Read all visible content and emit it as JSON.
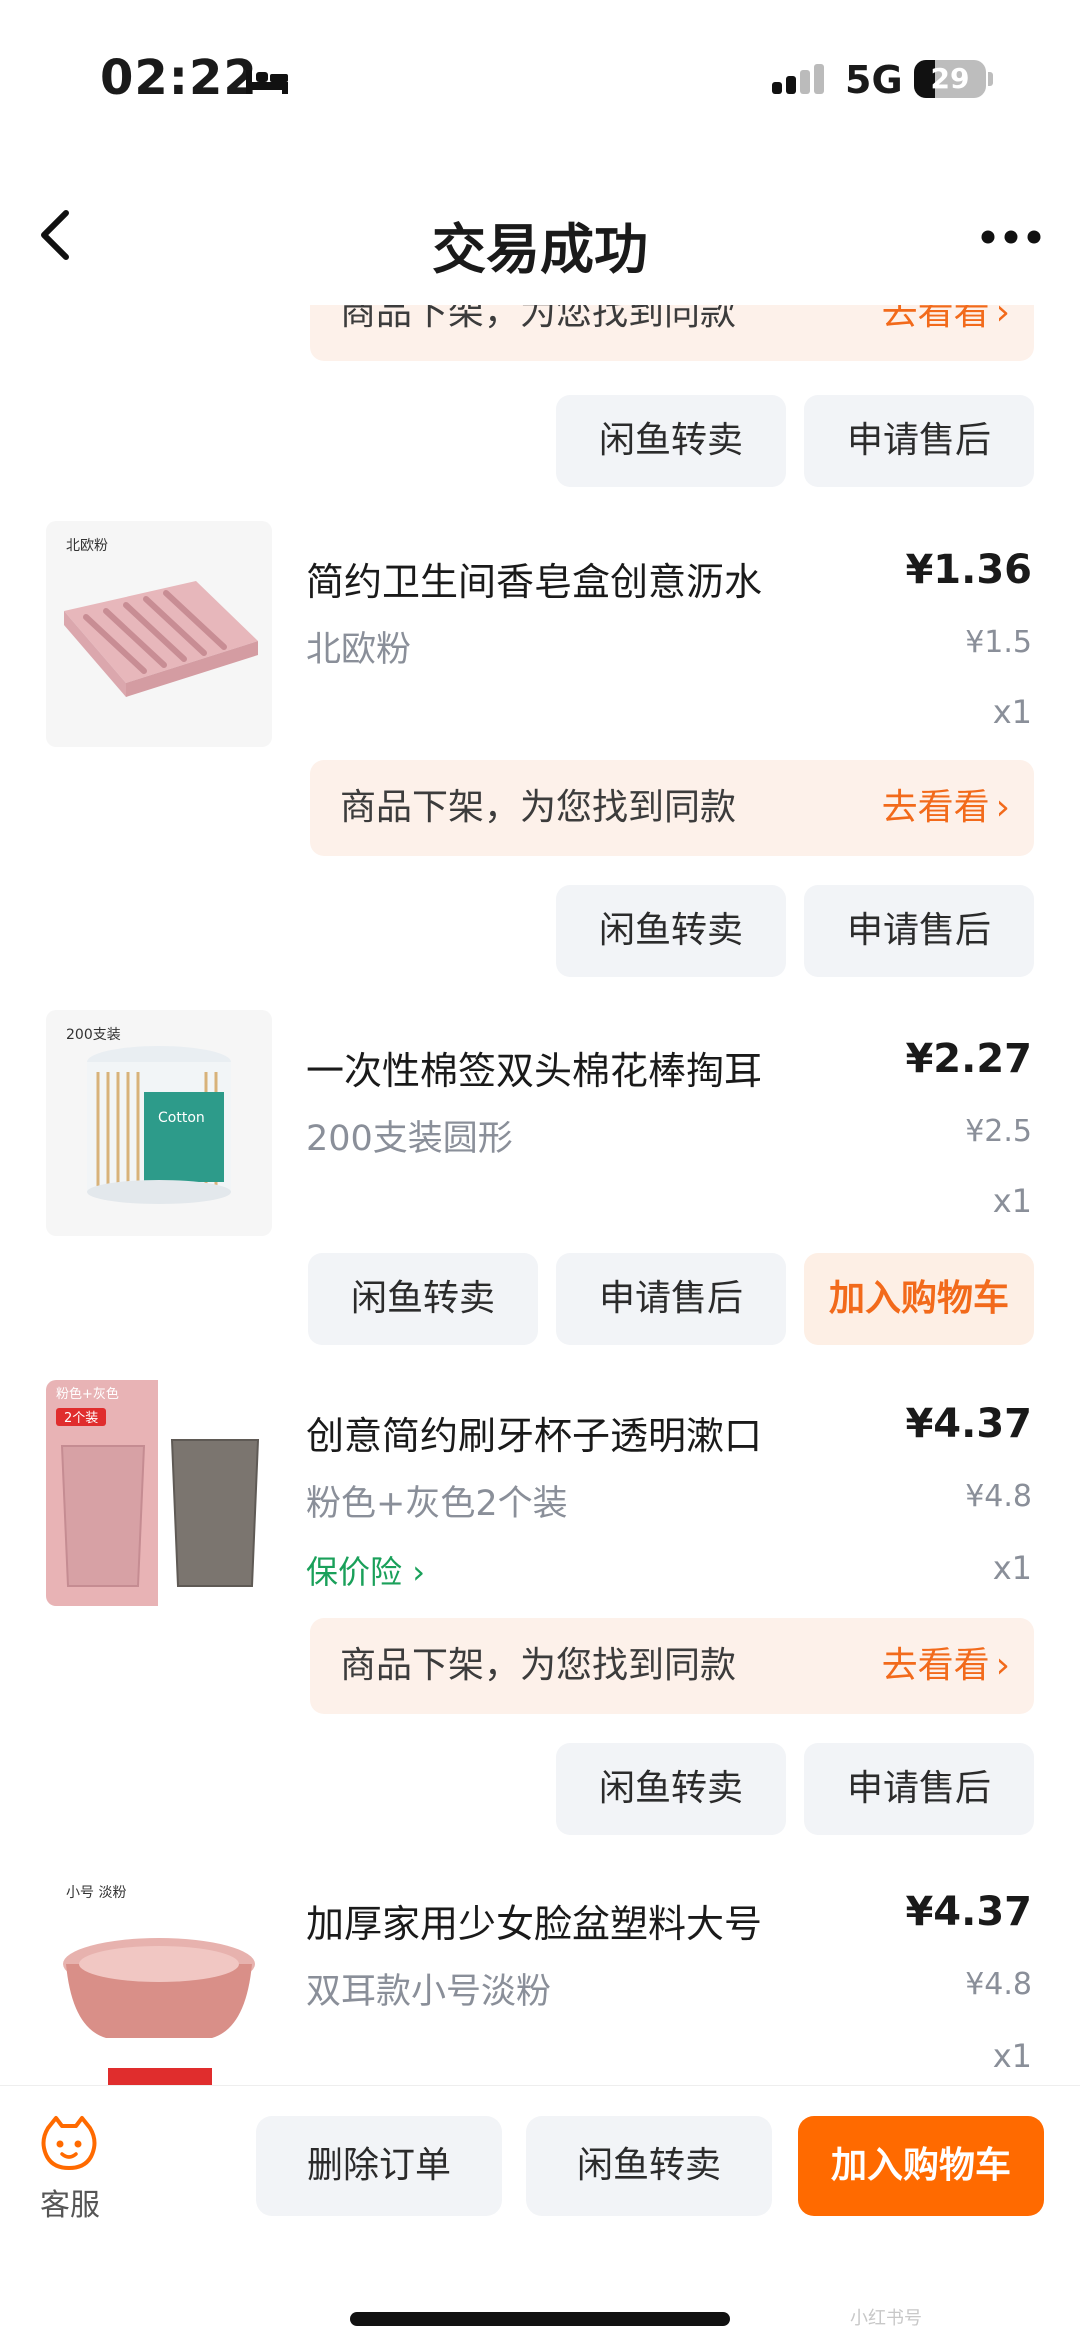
{
  "status_bar": {
    "time": "02:22",
    "network": "5G",
    "battery": "29",
    "battery_level": 0.29
  },
  "nav": {
    "title": "交易成功"
  },
  "notice": {
    "text": "商品下架，为您找到同款",
    "link": "去看看"
  },
  "actions": {
    "resell": "闲鱼转卖",
    "after_sale": "申请售后",
    "add_cart": "加入购物车"
  },
  "products": [
    {
      "img_tag": "北欧粉",
      "title": "简约卫生间香皂盒创意沥水",
      "spec": "北欧粉",
      "price": "¥1.36",
      "original_price": "¥1.5",
      "qty": "x1"
    },
    {
      "img_tag": "200支装",
      "title": "一次性棉签双头棉花棒掏耳",
      "spec": "200支装圆形",
      "price": "¥2.27",
      "original_price": "¥2.5",
      "qty": "x1"
    },
    {
      "img_tag": "粉色+灰色 2个装",
      "title": "创意简约刷牙杯子透明漱口",
      "spec": "粉色+灰色2个装",
      "insurance": "保价险",
      "price": "¥4.37",
      "original_price": "¥4.8",
      "qty": "x1"
    },
    {
      "img_tag": "小号 淡粉",
      "title": "加厚家用少女脸盆塑料大号",
      "spec": "双耳款小号淡粉",
      "price": "¥4.37",
      "original_price": "¥4.8",
      "qty": "x1"
    }
  ],
  "bottom_bar": {
    "service": "客服",
    "delete": "删除订单",
    "resell": "闲鱼转卖",
    "add_cart": "加入购物车"
  },
  "watermark": "小红书号",
  "colors": {
    "accent": "#ff6a00",
    "notice_bg": "#fdf1ea",
    "notice_link": "#f26a1b",
    "insurance": "#1aa05a"
  }
}
